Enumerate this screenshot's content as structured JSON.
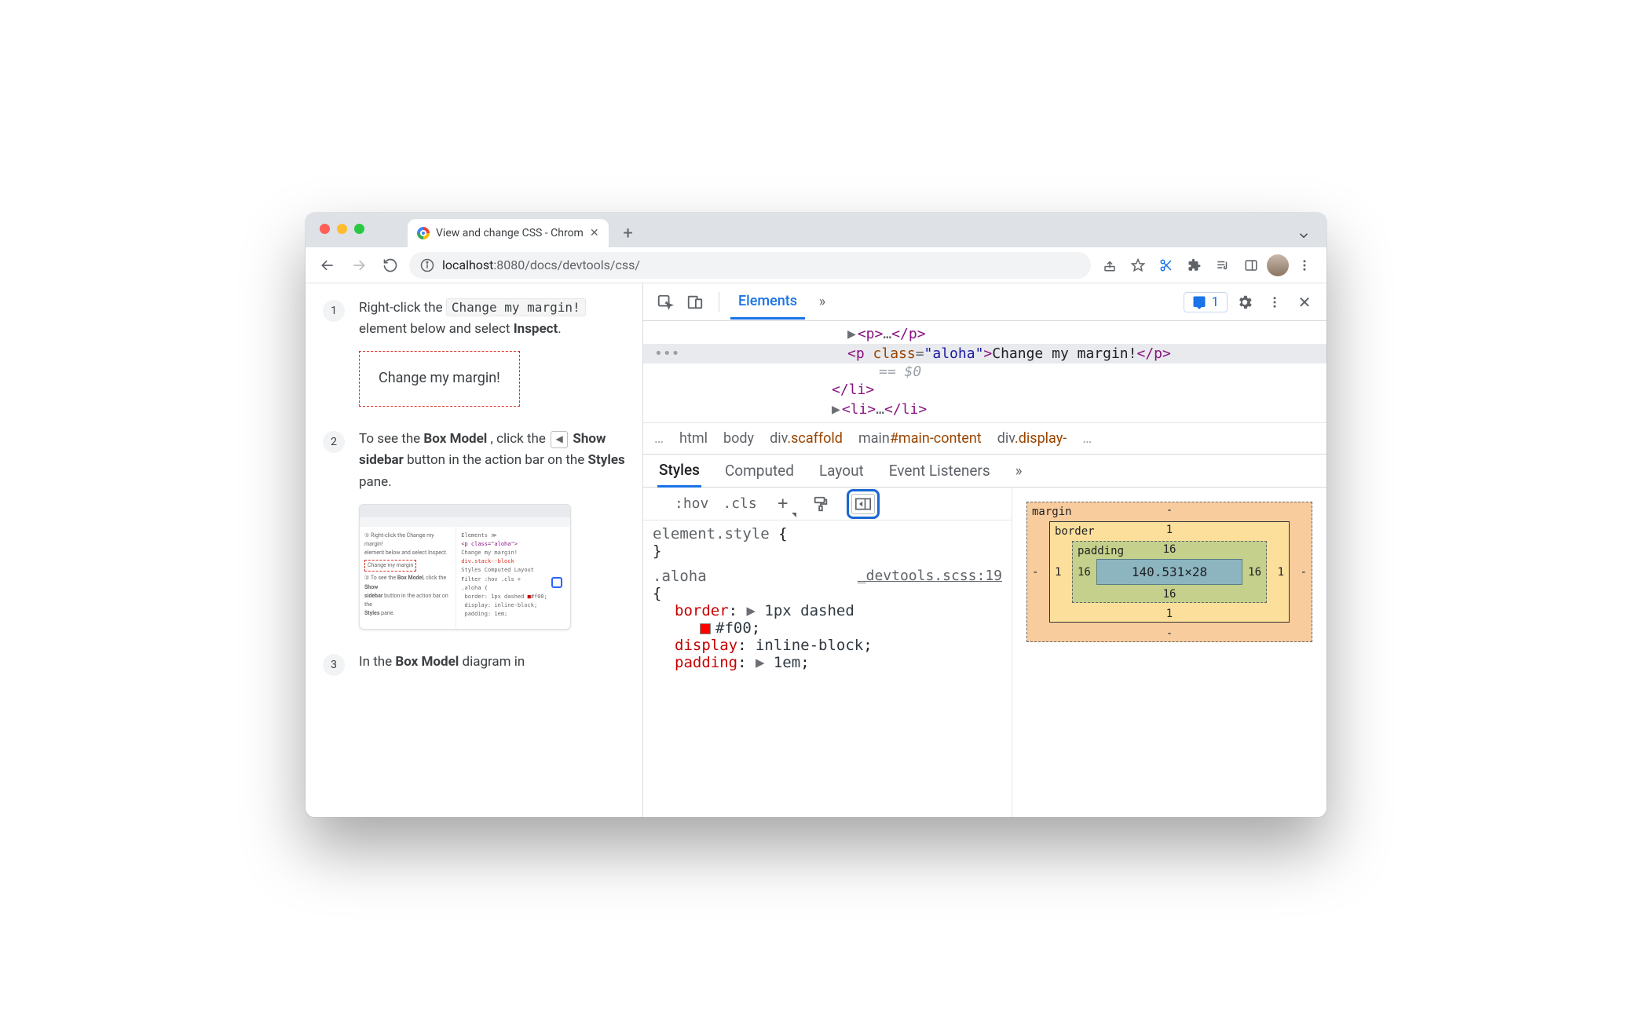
{
  "browser": {
    "tab_title": "View and change CSS - Chrom",
    "url_host": "localhost",
    "url_port": ":8080",
    "url_path": "/docs/devtools/css/"
  },
  "page": {
    "steps": [
      {
        "num": "1",
        "pre": "Right-click the ",
        "chip": "Change my margin!",
        "mid": " element below and select ",
        "bold": "Inspect",
        "post": ".",
        "demo_text": "Change my margin!"
      },
      {
        "num": "2",
        "pre": "To see the ",
        "bold1": "Box Model",
        "mid1": ", click the ",
        "bold2": "Show sidebar",
        "mid2": " button in the action bar on the ",
        "bold3": "Styles",
        "post": " pane."
      },
      {
        "num": "3",
        "pre": "In the ",
        "bold": "Box Model",
        "post": " diagram in"
      }
    ]
  },
  "devtools": {
    "main_tabs": {
      "elements": "Elements"
    },
    "issues_count": "1",
    "dom": {
      "l1": {
        "open": "<p>",
        "ell": "…",
        "close": "</p>"
      },
      "l2": {
        "open": "<p ",
        "attr": "class",
        "eq": "=",
        "val": "\"aloha\"",
        "close_open": ">",
        "text": "Change my margin!",
        "close": "</p>"
      },
      "eq0": "== $0",
      "l3": "</li>",
      "l4": {
        "open": "<li>",
        "ell": "…",
        "close": "</li>"
      }
    },
    "crumbs": {
      "ell": "…",
      "c1": "html",
      "c2": "body",
      "c3_pre": "div",
      "c3_sfx": ".scaffold",
      "c4_pre": "main",
      "c4_sfx": "#main-content",
      "c5_pre": "div",
      "c5_sfx": ".display-",
      "end": "…"
    },
    "sub_tabs": {
      "styles": "Styles",
      "computed": "Computed",
      "layout": "Layout",
      "listeners": "Event Listeners"
    },
    "toolbar": {
      "hov": ":hov",
      "cls": ".cls"
    },
    "rules": {
      "r1_sel": "element.style ",
      "r1_open": "{",
      "r1_close": "}",
      "r2_sel": ".aloha ",
      "r2_src": "_devtools.scss:19",
      "r2_open": "{",
      "border_p": "border",
      "border_v1": "1px dashed",
      "border_v2": "#f00",
      "display_p": "display",
      "display_v": "inline-block",
      "padding_p": "padding",
      "padding_v": "1em"
    },
    "box": {
      "margin_label": "margin",
      "border_label": "border",
      "padding_label": "padding",
      "margin": {
        "t": "-",
        "r": "-",
        "b": "-",
        "l": "-"
      },
      "border": {
        "t": "1",
        "r": "1",
        "b": "1",
        "l": "1"
      },
      "padding": {
        "t": "16",
        "r": "16",
        "b": "16",
        "l": "16"
      },
      "content": "140.531×28"
    }
  }
}
